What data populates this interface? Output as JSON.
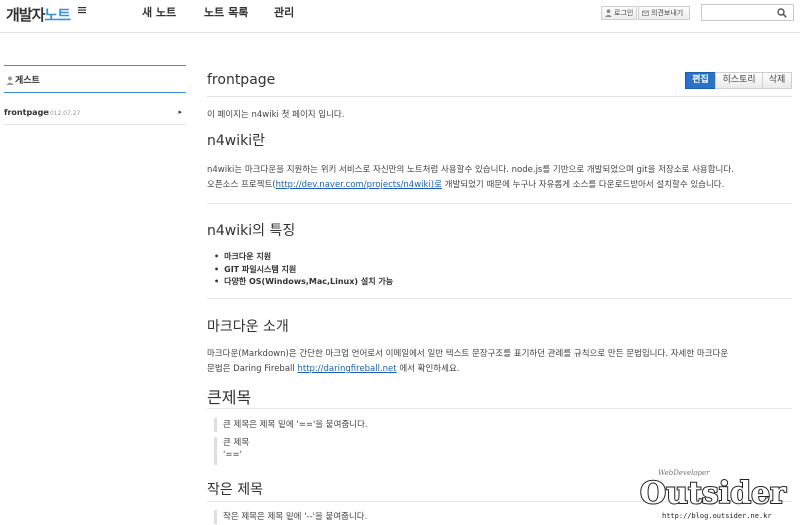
{
  "topbar": {
    "logo_a": "개발자",
    "logo_b": "노트",
    "nav": [
      "새 노트",
      "노트 목록",
      "관리"
    ],
    "login_label": "로그인",
    "feedback_label": "의견보내기",
    "search_placeholder": ""
  },
  "sidebar": {
    "user": "게스트",
    "items": [
      {
        "name": "frontpage",
        "date": "2012.07.27",
        "arrow": "▸"
      }
    ]
  },
  "main": {
    "title": "frontpage",
    "tabs": [
      "편집",
      "히스토리",
      "삭제"
    ],
    "intro": "이 페이지는 n4wiki 첫 페이지 입니다.",
    "s1_heading": "n4wiki란",
    "s1_p1": "n4wiki는 마크다운을 지원하는 위키 서비스로 자신만의 노트처럼 사용할수 있습니다. node.js를 기반으로 개발되었으며 git을 저장소로 사용합니다.",
    "s1_p2_pre": "오픈소스 프로젝트(",
    "s1_p2_link": "http://dev.naver.com/projects/n4wiki)로",
    "s1_p2_post": " 개발되었기 때문에 누구나 자유롭게 소스를 다운로드받아서 설치할수 있습니다.",
    "s2_heading": "n4wiki의 특징",
    "s2_items": [
      "마크다운 지원",
      "GIT 파일시스템 지원",
      "다양한 OS(Windows,Mac,Linux) 설치 가능"
    ],
    "s3_heading": "마크다운 소개",
    "s3_p1": "마크다운(Markdown)은 간단한 마크업 언어로서 이메일에서 일반 텍스트 문장구조를 표기하던 관례를 규칙으로 만든 문법입니다. 자세한 마크다운",
    "s3_p2_pre": "문법은 Daring Fireball ",
    "s3_p2_link": "http://daringfireball.net",
    "s3_p2_post": " 에서 확인하세요.",
    "h1_heading": "큰제목",
    "h1_quote": "큰 제목은 제목 밑에 '=='을 붙여줍니다.",
    "h1_code1": "큰 제목",
    "h1_code2": "'=='",
    "h2_heading": "작은 제목",
    "h2_quote": "작은 제목은 제목 밑에 '--'을 붙여줍니다."
  },
  "watermark": {
    "brand": "Outsider",
    "tag": "WebDeveloper",
    "url": "http://blog.outsider.ne.kr"
  },
  "colors": {
    "accent": "#2a72c6",
    "logo_blue": "#3a8fd9",
    "link": "#1a5fb4"
  }
}
